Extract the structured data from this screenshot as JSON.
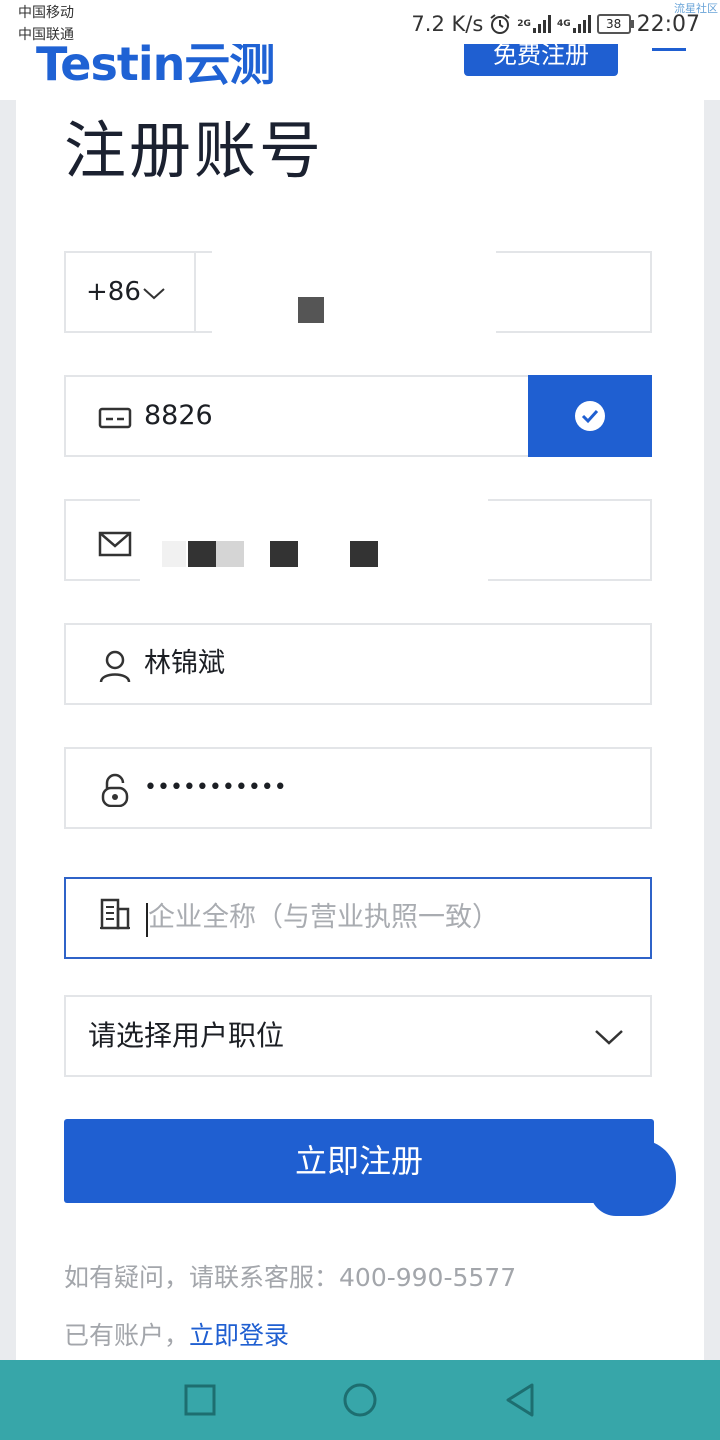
{
  "statusbar": {
    "carrier1": "中国移动",
    "carrier2": "中国联通",
    "speed": "7.2 K/s",
    "network1": "2G",
    "network2": "4G",
    "battery": "38",
    "time": "22:07",
    "corner_tag": "流星社区"
  },
  "header": {
    "logo_text": "Testin云测",
    "register_button": "免费注册"
  },
  "page": {
    "title": "注册账号"
  },
  "form": {
    "country_code": "+86",
    "phone_value": "",
    "captcha_value": "8826",
    "email_value": "",
    "name_value": "林锦斌",
    "password_value": "•••••••••••",
    "company_placeholder": "企业全称（与营业执照一致）",
    "role_select": "请选择用户职位",
    "submit_label": "立即注册"
  },
  "footer": {
    "help_text": "如有疑问，请联系客服：400-990-5577",
    "has_account": "已有账户，",
    "login_link": "立即登录"
  },
  "colors": {
    "primary": "#1f5fd1",
    "navbar": "#37a6a9"
  },
  "icons": [
    "chevron-down-icon",
    "captcha-card-icon",
    "check-circle-icon",
    "mail-icon",
    "user-icon",
    "lock-icon",
    "building-icon",
    "nav-square-icon",
    "nav-circle-icon",
    "nav-back-icon"
  ]
}
